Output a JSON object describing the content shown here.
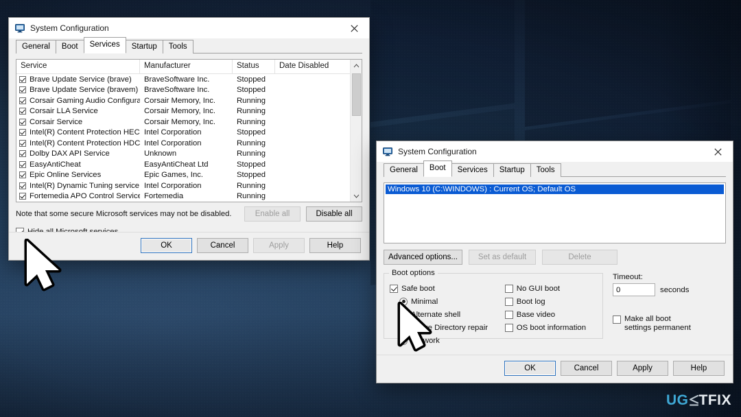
{
  "desktop": {
    "watermark": {
      "part1": "UG",
      "glyph": "less-equal-glyph",
      "part2": "TFIX"
    }
  },
  "dialog_services": {
    "title": "System Configuration",
    "icon": "system-configuration-icon",
    "close_label": "✕",
    "tabs": [
      {
        "label": "General",
        "active": false
      },
      {
        "label": "Boot",
        "active": false
      },
      {
        "label": "Services",
        "active": true
      },
      {
        "label": "Startup",
        "active": false
      },
      {
        "label": "Tools",
        "active": false
      }
    ],
    "columns": [
      "Service",
      "Manufacturer",
      "Status",
      "Date Disabled"
    ],
    "rows": [
      {
        "checked": true,
        "service": "Brave Update Service (brave)",
        "manufacturer": "BraveSoftware Inc.",
        "status": "Stopped",
        "date_disabled": ""
      },
      {
        "checked": true,
        "service": "Brave Update Service (bravem)",
        "manufacturer": "BraveSoftware Inc.",
        "status": "Stopped",
        "date_disabled": ""
      },
      {
        "checked": true,
        "service": "Corsair Gaming Audio Configurat...",
        "manufacturer": "Corsair Memory, Inc.",
        "status": "Running",
        "date_disabled": ""
      },
      {
        "checked": true,
        "service": "Corsair LLA Service",
        "manufacturer": "Corsair Memory, Inc.",
        "status": "Running",
        "date_disabled": ""
      },
      {
        "checked": true,
        "service": "Corsair Service",
        "manufacturer": "Corsair Memory, Inc.",
        "status": "Running",
        "date_disabled": ""
      },
      {
        "checked": true,
        "service": "Intel(R) Content Protection HEC...",
        "manufacturer": "Intel Corporation",
        "status": "Stopped",
        "date_disabled": ""
      },
      {
        "checked": true,
        "service": "Intel(R) Content Protection HDC...",
        "manufacturer": "Intel Corporation",
        "status": "Running",
        "date_disabled": ""
      },
      {
        "checked": true,
        "service": "Dolby DAX API Service",
        "manufacturer": "Unknown",
        "status": "Running",
        "date_disabled": ""
      },
      {
        "checked": true,
        "service": "EasyAntiCheat",
        "manufacturer": "EasyAntiCheat Ltd",
        "status": "Stopped",
        "date_disabled": ""
      },
      {
        "checked": true,
        "service": "Epic Online Services",
        "manufacturer": "Epic Games, Inc.",
        "status": "Stopped",
        "date_disabled": ""
      },
      {
        "checked": true,
        "service": "Intel(R) Dynamic Tuning service",
        "manufacturer": "Intel Corporation",
        "status": "Running",
        "date_disabled": ""
      },
      {
        "checked": true,
        "service": "Fortemedia APO Control Service",
        "manufacturer": "Fortemedia",
        "status": "Running",
        "date_disabled": ""
      }
    ],
    "note": "Note that some secure Microsoft services may not be disabled.",
    "enable_all_label": "Enable all",
    "disable_all_label": "Disable all",
    "hide_microsoft": {
      "label": "Hide all Microsoft services",
      "checked": true
    },
    "buttons": {
      "ok": "OK",
      "cancel": "Cancel",
      "apply": "Apply",
      "help": "Help"
    }
  },
  "dialog_boot": {
    "title": "System Configuration",
    "icon": "system-configuration-icon",
    "close_label": "✕",
    "tabs": [
      {
        "label": "General",
        "active": false
      },
      {
        "label": "Boot",
        "active": true
      },
      {
        "label": "Services",
        "active": false
      },
      {
        "label": "Startup",
        "active": false
      },
      {
        "label": "Tools",
        "active": false
      }
    ],
    "os_entry": "Windows 10 (C:\\WINDOWS) : Current OS; Default OS",
    "advanced_options_label": "Advanced options...",
    "set_as_default_label": "Set as default",
    "delete_label": "Delete",
    "boot_options": {
      "group_label": "Boot options",
      "safe_boot": {
        "label": "Safe boot",
        "checked": true
      },
      "safe_boot_modes": [
        {
          "label": "Minimal",
          "selected": true
        },
        {
          "label": "Alternate shell",
          "selected": false
        },
        {
          "label": "Active Directory repair",
          "selected": false
        },
        {
          "label": "Network",
          "selected": false
        }
      ],
      "extra_options": [
        {
          "label": "No GUI boot",
          "checked": false
        },
        {
          "label": "Boot log",
          "checked": false
        },
        {
          "label": "Base video",
          "checked": false
        },
        {
          "label": "OS boot information",
          "checked": false
        }
      ]
    },
    "timeout": {
      "label": "Timeout:",
      "value": "0",
      "unit": "seconds"
    },
    "make_permanent": {
      "label": "Make all boot settings permanent",
      "checked": false
    },
    "buttons": {
      "ok": "OK",
      "cancel": "Cancel",
      "apply": "Apply",
      "help": "Help"
    }
  }
}
